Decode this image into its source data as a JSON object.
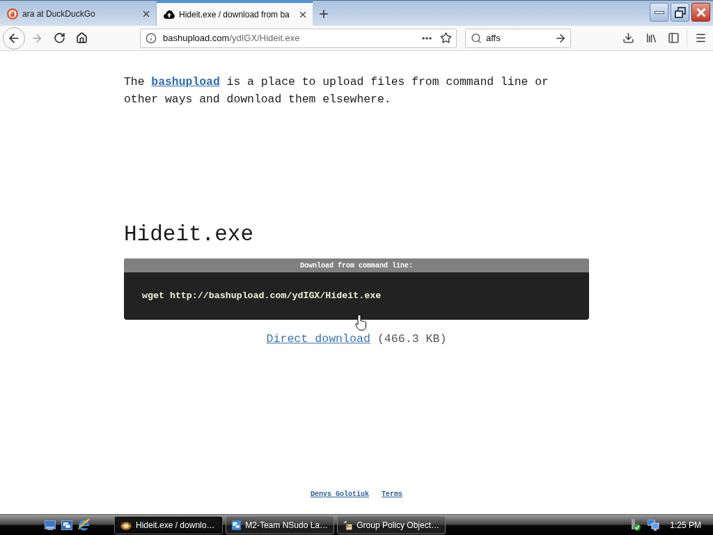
{
  "browser": {
    "tabs": [
      {
        "title": "ara at DuckDuckGo",
        "kind": "duck",
        "selected": false
      },
      {
        "title": "Hideit.exe / download from ba",
        "kind": "cloud",
        "selected": true
      }
    ],
    "nav_buttons": [
      {
        "kind": "back",
        "disabled": false
      },
      {
        "kind": "forward",
        "disabled": true
      },
      {
        "kind": "reload",
        "disabled": false
      },
      {
        "kind": "home",
        "disabled": false
      }
    ],
    "address_bar": {
      "host": "bashupload.com",
      "path": "/ydIGX/Hideit.exe"
    },
    "search_field": {
      "value": "affs"
    }
  },
  "page": {
    "intro": {
      "before": "The",
      "link": "bashupload",
      "after": "is a place to upload files from command line or other ways and download them elsewhere."
    },
    "file_name": "Hideit.exe",
    "command_box": {
      "title": "Download from command line:",
      "command": "wget http://bashupload.com/ydIGX/Hideit.exe"
    },
    "download": {
      "link": "Direct download",
      "size": "(466.3 KB)"
    },
    "footer_links": [
      "Denys Golotiuk",
      "Terms"
    ]
  },
  "taskbar": {
    "buttons": [
      {
        "label": "Hideit.exe / downlo…",
        "kind": "browser",
        "selected": true
      },
      {
        "label": "M2-Team NSudo La…",
        "kind": "shell",
        "selected": false
      },
      {
        "label": "Group Policy Object…",
        "kind": "policy",
        "selected": false
      }
    ],
    "clock": "1:25 PM"
  }
}
